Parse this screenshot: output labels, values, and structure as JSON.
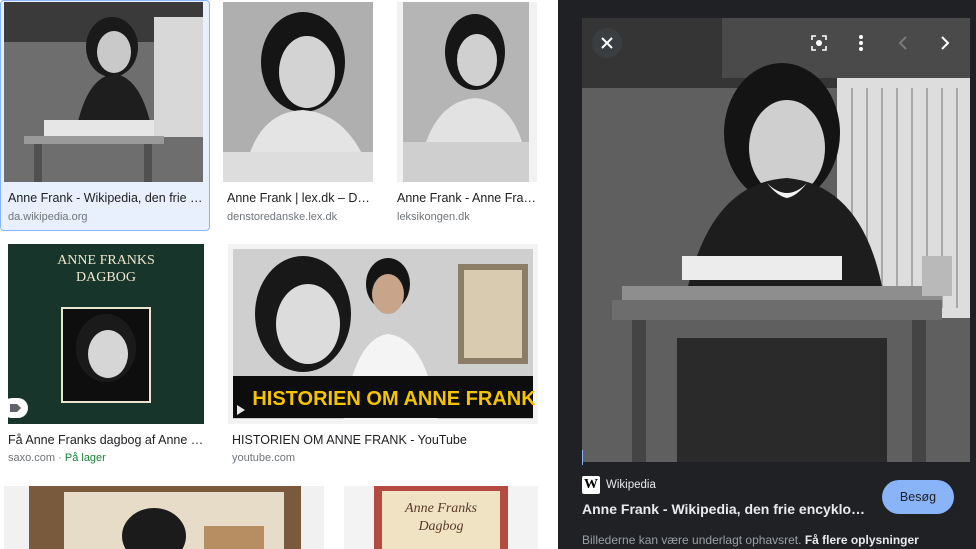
{
  "results": [
    {
      "title": "Anne Frank - Wikipedia, den frie e…",
      "source": "da.wikipedia.org",
      "stock": ""
    },
    {
      "title": "Anne Frank | lex.dk – De…",
      "source": "denstoredanske.lex.dk",
      "stock": ""
    },
    {
      "title": "Anne Frank - Anne Fran…",
      "source": "leksikongen.dk",
      "stock": ""
    },
    {
      "title": "Få Anne Franks dagbog af Anne F…",
      "source": "saxo.com",
      "source_sep": " · ",
      "stock": "På lager",
      "book_title": "ANNE FRANKS\nDAGBOG"
    },
    {
      "title": "HISTORIEN OM ANNE FRANK - YouTube",
      "source": "youtube.com",
      "stock": "",
      "banner": "HISTORIEN OM ANNE FRANK"
    },
    {
      "title": "",
      "source": "",
      "stock": ""
    },
    {
      "title": "",
      "source": "",
      "stock": "",
      "book_title": "Anne Franks Dagbog"
    }
  ],
  "book_line1": "ANNE FRANKS",
  "book_line2": "DAGBOG",
  "book2_line1": "Anne Franks",
  "book2_line2": "Dagbog",
  "panel": {
    "source_name": "Wikipedia",
    "title": "Anne Frank - Wikipedia, den frie encyklo…",
    "visit_label": "Besøg",
    "copyright": "Billederne kan være underlagt ophavsret.",
    "more_info": "Få flere oplysninger",
    "logo_letter": "W"
  },
  "colors": {
    "accent": "#8ab4f8",
    "panel_bg": "#202124",
    "stock_green": "#188038"
  },
  "icons": [
    "close-icon",
    "lens-icon",
    "more-vert-icon",
    "chevron-left-icon",
    "chevron-right-icon",
    "tag-icon",
    "play-icon",
    "wikipedia-icon"
  ]
}
